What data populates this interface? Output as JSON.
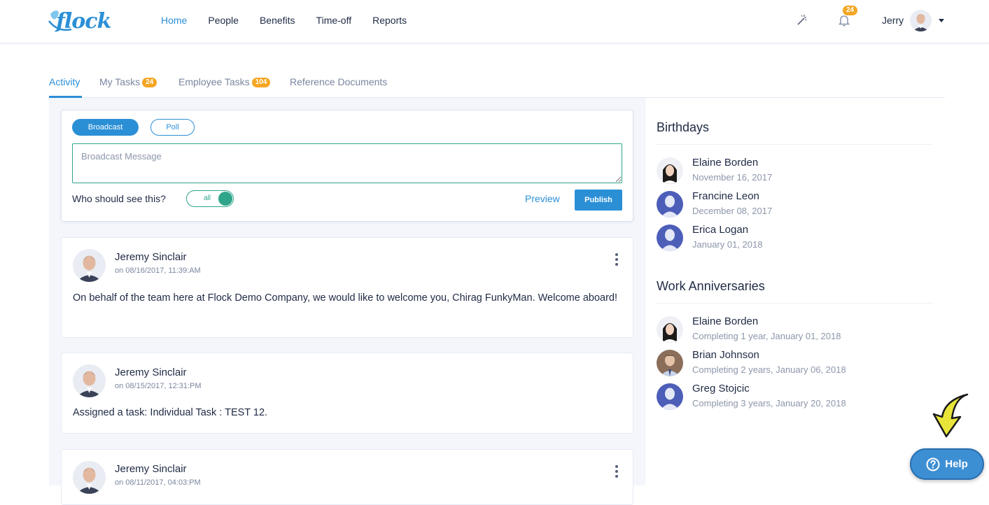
{
  "header": {
    "logo_text": "flock",
    "nav": [
      "Home",
      "People",
      "Benefits",
      "Time-off",
      "Reports"
    ],
    "active_nav": "Home",
    "notifications_count": "24",
    "user_name": "Jerry"
  },
  "tabs": [
    {
      "label": "Activity",
      "badge": ""
    },
    {
      "label": "My Tasks",
      "badge": "24"
    },
    {
      "label": "Employee Tasks",
      "badge": "104"
    },
    {
      "label": "Reference Documents",
      "badge": ""
    }
  ],
  "composer": {
    "broadcast_label": "Broadcast",
    "poll_label": "Poll",
    "message_placeholder": "Broadcast Message",
    "who_label": "Who should see this?",
    "toggle_value": "all",
    "preview_label": "Preview",
    "publish_label": "Publish"
  },
  "posts": [
    {
      "author": "Jeremy Sinclair",
      "time": "on 08/16/2017, 11:39:AM",
      "body": "On behalf of the team here at Flock Demo Company, we would like to welcome you, Chirag FunkyMan. Welcome aboard!"
    },
    {
      "author": "Jeremy Sinclair",
      "time": "on 08/15/2017, 12:31:PM",
      "body": "Assigned a task: Individual Task : TEST 12."
    },
    {
      "author": "Jeremy Sinclair",
      "time": "on 08/11/2017, 04:03:PM",
      "body": ""
    }
  ],
  "birthdays": {
    "title": "Birthdays",
    "people": [
      {
        "name": "Elaine Borden",
        "sub": "November 16, 2017"
      },
      {
        "name": "Francine Leon",
        "sub": "December 08, 2017"
      },
      {
        "name": "Erica Logan",
        "sub": "January 01, 2018"
      }
    ]
  },
  "anniversaries": {
    "title": "Work Anniversaries",
    "people": [
      {
        "name": "Elaine Borden",
        "sub": "Completing 1 year, January 01, 2018"
      },
      {
        "name": "Brian Johnson",
        "sub": "Completing 2 years, January 06, 2018"
      },
      {
        "name": "Greg Stojcic",
        "sub": "Completing 3 years, January 20, 2018"
      }
    ]
  },
  "help": {
    "label": "Help"
  },
  "colors": {
    "accent": "#2b8fd6",
    "toggle": "#2fa58a",
    "badge": "#f5a623",
    "arrow": "#e8e43a"
  }
}
